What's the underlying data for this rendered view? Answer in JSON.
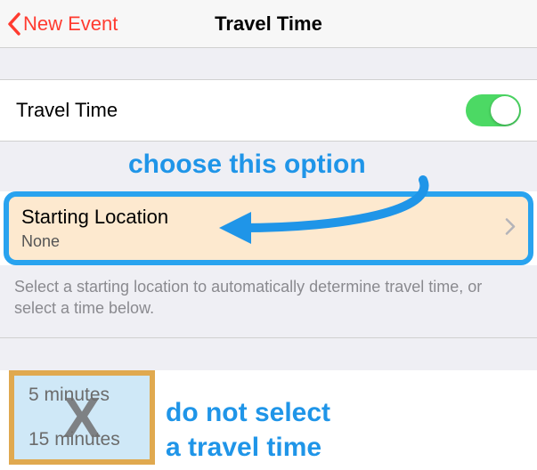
{
  "nav": {
    "back_label": "New Event",
    "title": "Travel Time"
  },
  "travel_toggle": {
    "label": "Travel Time",
    "on": true
  },
  "starting_location": {
    "title": "Starting Location",
    "value": "None"
  },
  "description": "Select a starting location to automatically determine travel time, or select a time below.",
  "time_options": {
    "opt1": "5 minutes",
    "opt2": "15 minutes"
  },
  "annotations": {
    "choose": "choose this option",
    "do_not_1": "do not select",
    "do_not_2": "a travel time",
    "x": "X"
  }
}
